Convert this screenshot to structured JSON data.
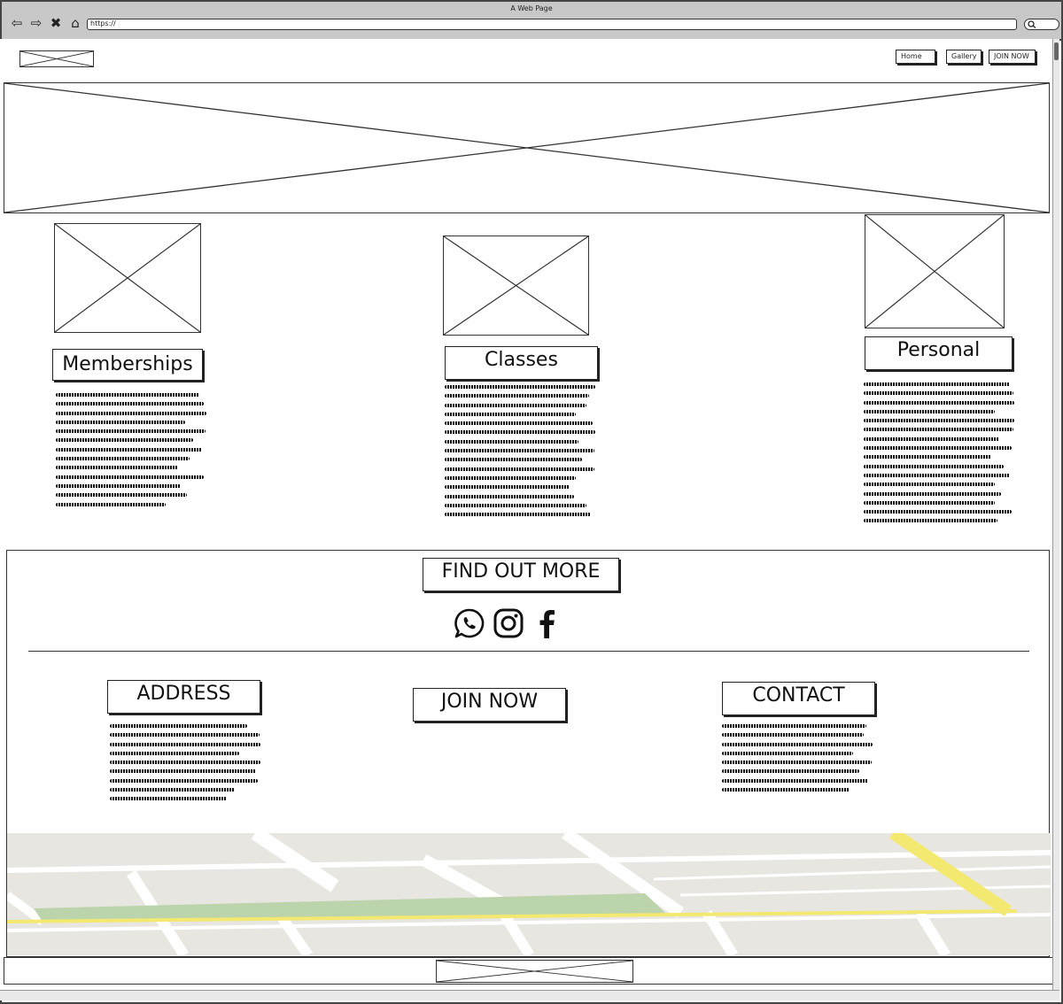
{
  "browser": {
    "window_title": "A Web Page",
    "url": "https://",
    "nav_icons": [
      "back-arrow-icon",
      "forward-arrow-icon",
      "close-icon",
      "home-icon"
    ],
    "search_icon": "search-icon"
  },
  "header": {
    "logo": "image-placeholder",
    "nav": [
      {
        "label": "Home"
      },
      {
        "label": "Gallery"
      },
      {
        "label": "JOIN NOW"
      }
    ]
  },
  "hero": {
    "image": "image-placeholder"
  },
  "features": [
    {
      "title": "Memberships",
      "image": "image-placeholder"
    },
    {
      "title": "Classes",
      "image": "image-placeholder"
    },
    {
      "title": "Personal",
      "image": "image-placeholder"
    }
  ],
  "footer": {
    "cta_label": "FIND OUT MORE",
    "socials": [
      "whatsapp-icon",
      "instagram-icon",
      "facebook-icon"
    ],
    "columns": [
      {
        "title": "ADDRESS"
      },
      {
        "title": "JOIN NOW"
      },
      {
        "title": "CONTACT"
      }
    ],
    "map": "map-image",
    "bottom_logo": "image-placeholder"
  },
  "colors": {
    "ink": "#222222",
    "chrome": "#c8c8c8",
    "map_bg": "#e8e6e0",
    "map_park": "#bcd4ac",
    "map_road_major": "#f3e870"
  }
}
